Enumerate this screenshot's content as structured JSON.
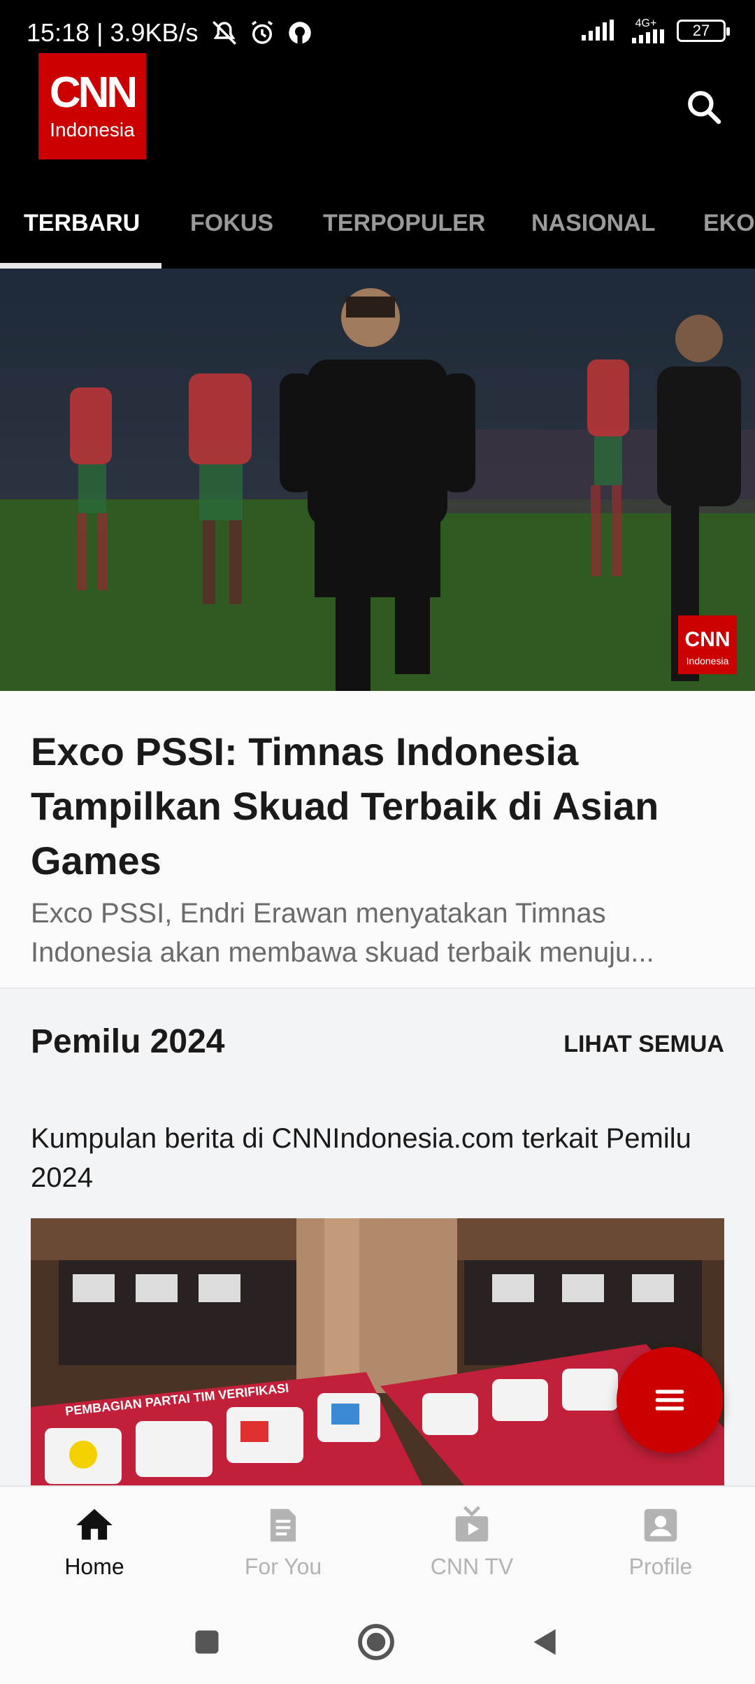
{
  "status_bar": {
    "time": "15:18",
    "speed": "3.9KB/s",
    "network": "4G+",
    "battery": "27"
  },
  "header": {
    "logo_main": "CNN",
    "logo_sub": "Indonesia"
  },
  "tabs": [
    {
      "label": "TERBARU",
      "active": true
    },
    {
      "label": "FOKUS",
      "active": false
    },
    {
      "label": "TERPOPULER",
      "active": false
    },
    {
      "label": "NASIONAL",
      "active": false
    },
    {
      "label": "EKO",
      "active": false
    }
  ],
  "hero": {
    "watermark_main": "CNN",
    "watermark_sub": "Indonesia",
    "title": "Exco PSSI: Timnas Indonesia Tampilkan Skuad Terbaik di Asian Games",
    "description": "Exco PSSI, Endri Erawan menyatakan Timnas Indonesia akan membawa skuad terbaik menuju..."
  },
  "section": {
    "title": "Pemilu 2024",
    "see_all": "LIHAT SEMUA",
    "description": "Kumpulan berita di CNNIndonesia.com terkait Pemilu 2024",
    "image_text": "PEMBAGIAN PARTAI TIM VERIFIKASI"
  },
  "bottom_nav": [
    {
      "label": "Home",
      "icon": "home-icon",
      "active": true
    },
    {
      "label": "For You",
      "icon": "document-icon",
      "active": false
    },
    {
      "label": "CNN TV",
      "icon": "tv-icon",
      "active": false
    },
    {
      "label": "Profile",
      "icon": "profile-icon",
      "active": false
    }
  ],
  "colors": {
    "brand_red": "#cc0000",
    "header_bg": "#000000",
    "tab_inactive": "#9a9a9a"
  }
}
